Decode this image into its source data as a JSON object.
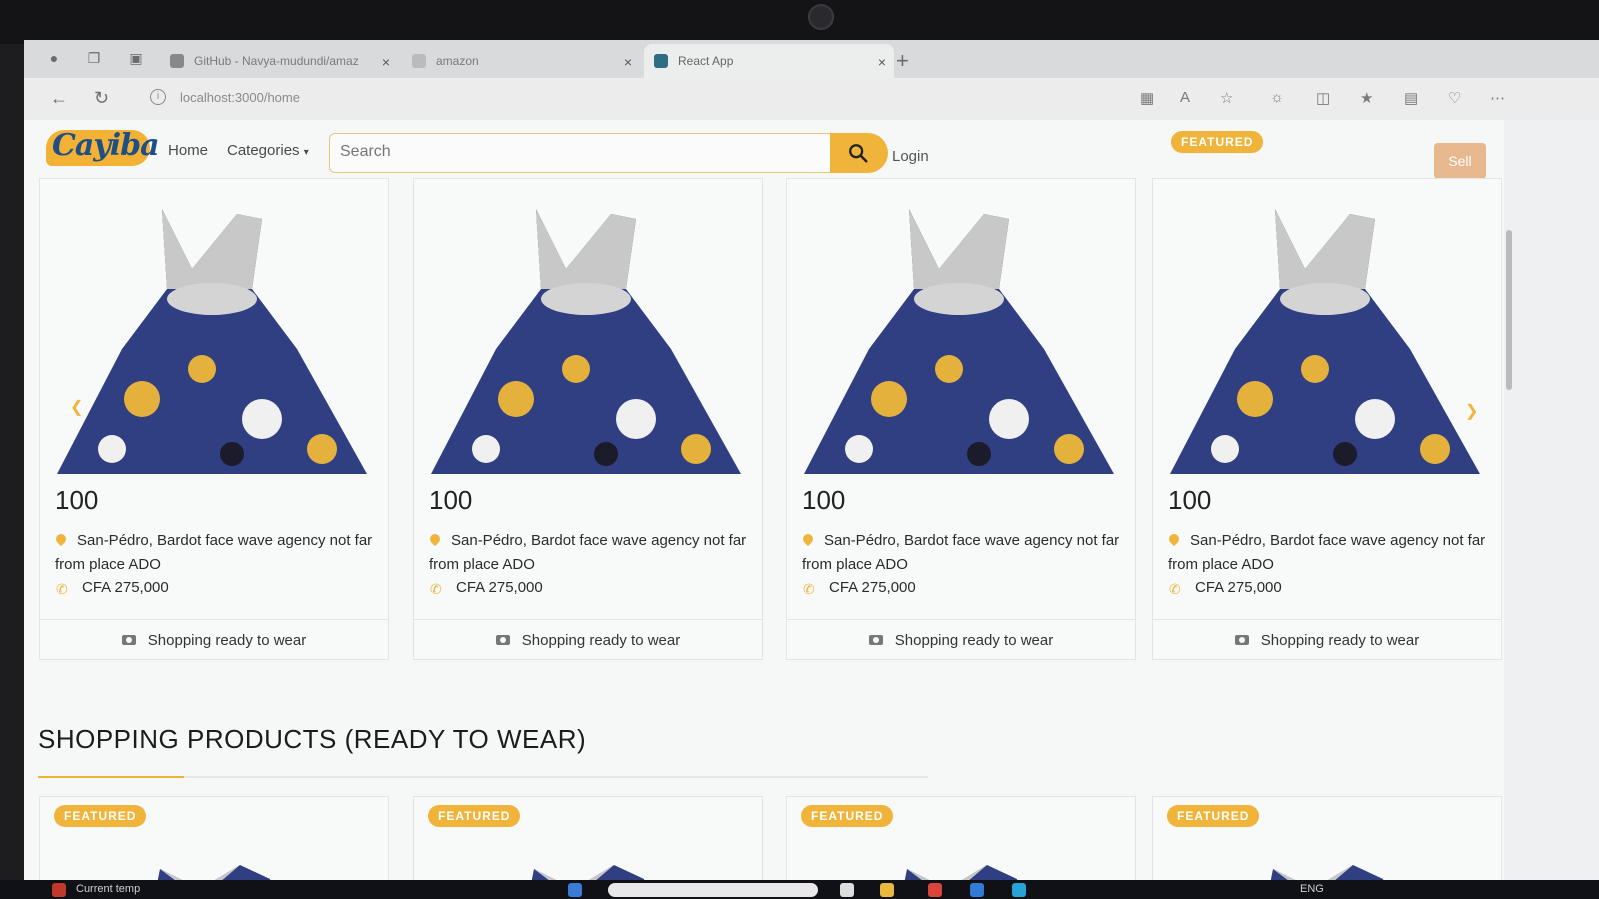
{
  "browser": {
    "tabs": [
      {
        "label": "GitHub - Navya-mudundi/amaz",
        "active": false
      },
      {
        "label": "amazon",
        "active": false
      },
      {
        "label": "React App",
        "active": true
      }
    ],
    "url": "localhost:3000/home"
  },
  "header": {
    "logo_text": "Cayiba",
    "nav": [
      "Home",
      "Categories"
    ],
    "search_placeholder": "Search",
    "login_label": "Login",
    "sell_label": "Sell"
  },
  "featured_badge": "FEATURED",
  "products": [
    {
      "price": "100",
      "location": "San-Pédro, Bardot face wave agency not far from place ADO",
      "phone": "CFA 275,000",
      "category": "Shopping ready to wear",
      "featured": false
    },
    {
      "price": "100",
      "location": "San-Pédro, Bardot face wave agency not far from place ADO",
      "phone": "CFA 275,000",
      "category": "Shopping ready to wear",
      "featured": false
    },
    {
      "price": "100",
      "location": "San-Pédro, Bardot face wave agency not far from place ADO",
      "phone": "CFA 275,000",
      "category": "Shopping ready to wear",
      "featured": false
    },
    {
      "price": "100",
      "location": "San-Pédro, Bardot face wave agency not far from place ADO",
      "phone": "CFA 275,000",
      "category": "Shopping ready to wear",
      "featured": true
    }
  ],
  "section_title": "SHOPPING PRODUCTS (READY TO WEAR)",
  "taskbar": {
    "weather": "Current temp",
    "lang": "ENG"
  },
  "colors": {
    "accent": "#f0b43a",
    "logo_blue": "#1f4f86",
    "logo_red": "#d6322c"
  }
}
